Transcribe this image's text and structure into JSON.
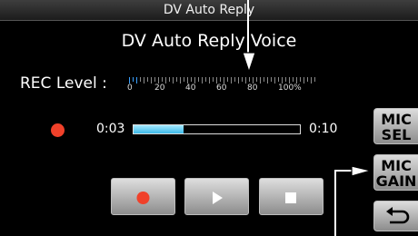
{
  "window": {
    "title": "DV Auto Reply"
  },
  "screen": {
    "heading": "DV Auto Reply Voice"
  },
  "rec_level": {
    "label": "REC Level :",
    "scale_labels": [
      "0",
      "20",
      "40",
      "60",
      "80",
      "100%"
    ],
    "level_percent": 5
  },
  "playback": {
    "elapsed": "0:03",
    "total": "0:10",
    "progress_percent": 30
  },
  "side_buttons": {
    "mic_sel": {
      "line1": "MIC",
      "line2": "SEL"
    },
    "mic_gain": {
      "line1": "MIC",
      "line2": "GAIN"
    },
    "back_icon": "return-arrow-icon"
  },
  "controls": {
    "record_icon": "record-icon",
    "play_icon": "play-icon",
    "stop_icon": "stop-icon"
  },
  "colors": {
    "record_red": "#f0412a",
    "progress_blue": "#3bb9e8",
    "meter_blue": "#3aa0ff"
  }
}
